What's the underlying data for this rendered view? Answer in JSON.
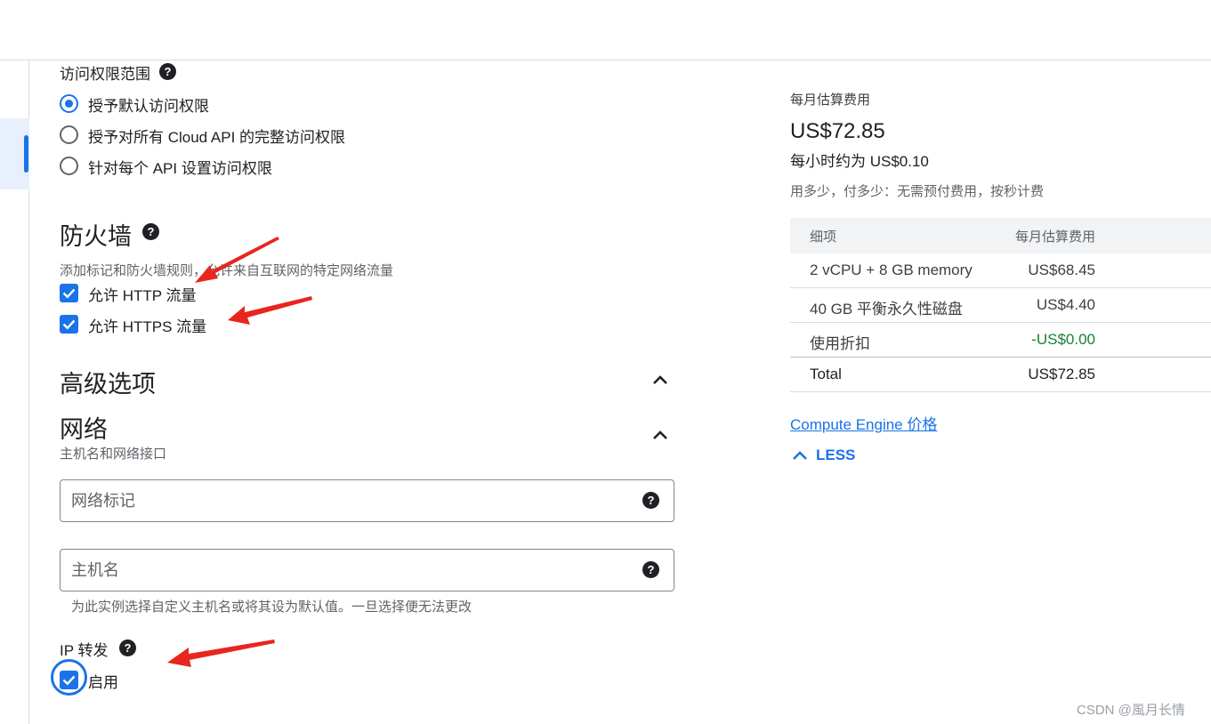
{
  "access_scope": {
    "title": "访问权限范围",
    "options": [
      {
        "label": "授予默认访问权限",
        "selected": true
      },
      {
        "label": "授予对所有 Cloud API 的完整访问权限",
        "selected": false
      },
      {
        "label": "针对每个 API 设置访问权限",
        "selected": false
      }
    ]
  },
  "firewall": {
    "title": "防火墙",
    "description": "添加标记和防火墙规则，允许来自互联网的特定网络流量",
    "options": [
      {
        "label": "允许 HTTP 流量",
        "checked": true
      },
      {
        "label": "允许 HTTPS 流量",
        "checked": true
      }
    ]
  },
  "advanced": {
    "title": "高级选项"
  },
  "network": {
    "title": "网络",
    "subtitle": "主机名和网络接口",
    "tags_placeholder": "网络标记",
    "hostname_placeholder": "主机名",
    "hostname_hint": "为此实例选择自定义主机名或将其设为默认值。一旦选择便无法更改"
  },
  "ip_forwarding": {
    "title": "IP 转发",
    "enable_label": "启用",
    "checked": true
  },
  "pricing": {
    "heading": "每月估算费用",
    "monthly_total": "US$72.85",
    "hourly": "每小时约为 US$0.10",
    "note": "用多少，付多少：无需预付费用，按秒计费",
    "table": {
      "col_item": "细项",
      "col_cost": "每月估算费用",
      "rows": [
        {
          "item": "2 vCPU + 8 GB memory",
          "cost": "US$68.45"
        },
        {
          "item": "40 GB 平衡永久性磁盘",
          "cost": "US$4.40"
        },
        {
          "item": "使用折扣",
          "cost": "-US$0.00"
        }
      ],
      "total_label": "Total",
      "total_value": "US$72.85"
    },
    "link": "Compute Engine 价格",
    "less_label": "LESS"
  },
  "watermark": "CSDN @風月长情",
  "colors": {
    "accent": "#1a73e8",
    "discount_green": "#188038",
    "annotation_red": "#e8251f"
  },
  "icons": [
    "help-icon",
    "chevron-up-icon",
    "checkbox-checked-icon",
    "radio-icon"
  ]
}
